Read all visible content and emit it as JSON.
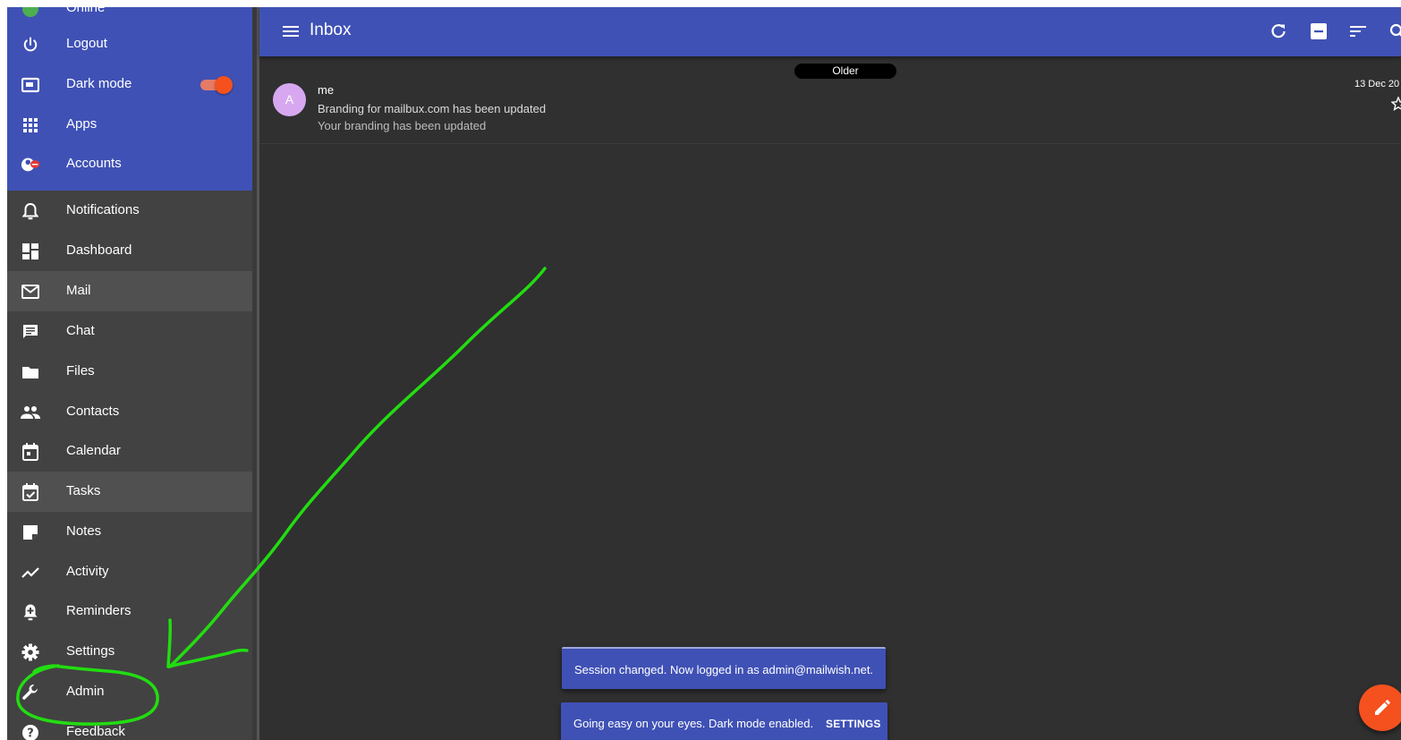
{
  "sidebar": {
    "partial_item": "Online",
    "top_items": [
      {
        "label": "Logout",
        "icon": "power-icon"
      },
      {
        "label": "Dark mode",
        "icon": "dark-mode-icon"
      },
      {
        "label": "Apps",
        "icon": "apps-grid-icon"
      },
      {
        "label": "Accounts",
        "icon": "accounts-icon"
      }
    ],
    "dark_mode_on": true,
    "items": [
      {
        "label": "Notifications",
        "icon": "bell-icon"
      },
      {
        "label": "Dashboard",
        "icon": "dashboard-icon"
      },
      {
        "label": "Mail",
        "icon": "mail-icon",
        "active": true
      },
      {
        "label": "Chat",
        "icon": "chat-icon"
      },
      {
        "label": "Files",
        "icon": "folder-icon"
      },
      {
        "label": "Contacts",
        "icon": "people-icon"
      },
      {
        "label": "Calendar",
        "icon": "calendar-icon"
      },
      {
        "label": "Tasks",
        "icon": "task-check-icon",
        "active": true
      },
      {
        "label": "Notes",
        "icon": "note-icon"
      },
      {
        "label": "Activity",
        "icon": "activity-icon"
      },
      {
        "label": "Reminders",
        "icon": "reminder-bell-icon"
      },
      {
        "label": "Settings",
        "icon": "gear-icon"
      },
      {
        "label": "Admin",
        "icon": "wrench-icon"
      },
      {
        "label": "Feedback",
        "icon": "help-icon"
      }
    ]
  },
  "header": {
    "title": "Inbox",
    "icons": [
      "menu-icon",
      "refresh-icon",
      "select-icon",
      "sort-icon",
      "search-icon"
    ]
  },
  "inbox": {
    "group_label": "Older",
    "messages": [
      {
        "avatar": "A",
        "sender": "me",
        "subject": "Branding for mailbux.com has been updated",
        "snippet": "Your branding has been updated",
        "date": "13 Dec 20"
      }
    ]
  },
  "snackbars": {
    "session": "Session changed. Now logged in as admin@mailwish.net.",
    "dark": "Going easy on your eyes. Dark mode enabled.",
    "dark_action": "SETTINGS"
  },
  "colors": {
    "primary": "#3f51b5",
    "accent": "#f4511e",
    "background": "#303030",
    "sidebar": "#424242",
    "annotation": "#22dd11"
  }
}
